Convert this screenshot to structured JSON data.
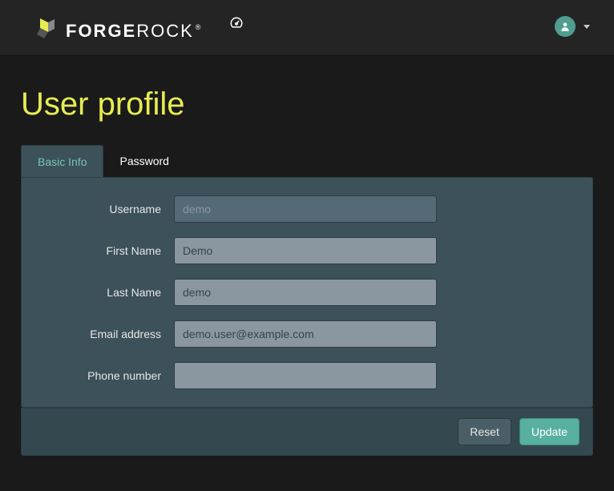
{
  "brand": {
    "bold": "FORGE",
    "light": "ROCK"
  },
  "page": {
    "title": "User profile"
  },
  "tabs": {
    "basic": "Basic Info",
    "password": "Password"
  },
  "form": {
    "username": {
      "label": "Username",
      "value": "demo"
    },
    "firstname": {
      "label": "First Name",
      "value": "Demo"
    },
    "lastname": {
      "label": "Last Name",
      "value": "demo"
    },
    "email": {
      "label": "Email address",
      "value": "demo.user@example.com"
    },
    "phone": {
      "label": "Phone number",
      "value": ""
    }
  },
  "buttons": {
    "reset": "Reset",
    "update": "Update"
  }
}
